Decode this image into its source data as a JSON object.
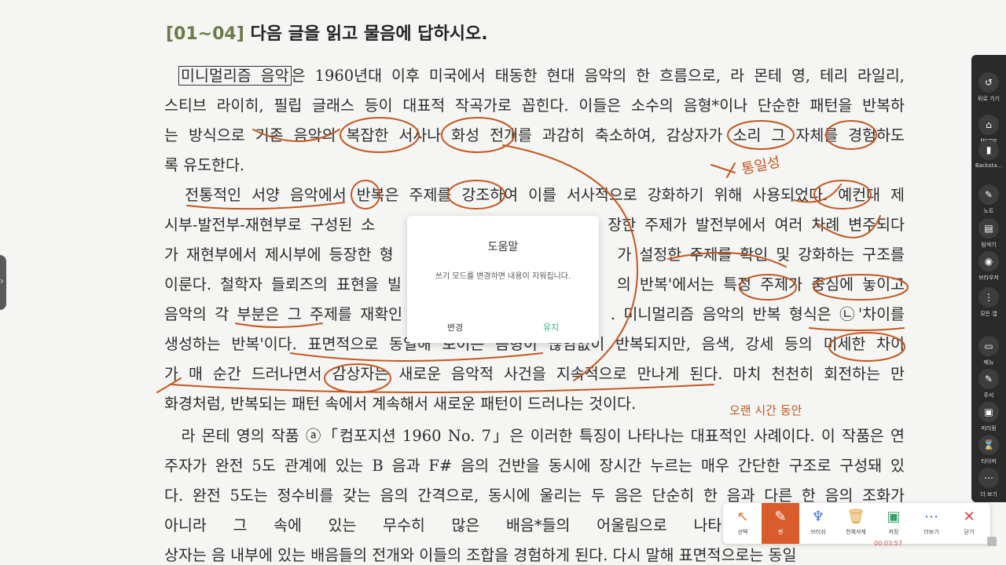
{
  "heading": {
    "num": "[01~04]",
    "text": "다음 글을 읽고 물음에 답하시오."
  },
  "paragraphs": [
    {
      "boxed": "미니멀리즘 음악",
      "lines": [
        "은 1960년대 이후 미국에서 태동한 현대 음악의 한 흐름으로, 라 몬테 영, 테리 라일리,",
        "스티브 라이히, 필립 글래스 등이 대표적 작곡가로 꼽힌다. 이들은 소수의 음형*이나 단순한 패턴을 반복하",
        "는 방식으로 기존 음악의 복잡한 서사나 화성 전개를 과감히 축소하여, 감상자가 소리 그 자체를 경험하도",
        "록 유도한다."
      ]
    },
    {
      "lines": [
        "　전통적인 서양 음악에서 반복은 주제를 강조하여 이를 서사적으로 강화하기 위해 사용되었다. 예컨대 제",
        "시부-발전부-재현부로 구성된 소　　　　　　　　　　　　장한 주제가 발전부에서 여러 차례 변주되다",
        "가 재현부에서 제시부에 등장한 형　　　　　　　　　　　　가 설정한 주제를 확인 및 강화하는 구조를",
        "이룬다. 철학자 들뢰즈의 표현을 빌　　　　　　　　　　　의 반복'에서는 특정 주제가 중심에 놓이고",
        "음악의 각 부분은 그 주제를 재확인　　　　　　　　　　　. 미니멀리즘 음악의 반복 형식은 ㉡'차이를",
        "생성하는 반복'이다. 표면적으로 동일해 보이는 음형이 끊임없이 반복되지만, 음색, 강세 등의 미세한 차이",
        "가 매 순간 드러나면서 감상자는 새로운 음악적 사건을 지속적으로 만나게 된다. 마치 천천히 회전하는 만",
        "화경처럼, 반복되는 패턴 속에서 계속해서 새로운 패턴이 드러나는 것이다."
      ]
    },
    {
      "lines": [
        "　라 몬테 영의 작품 ⓐ「컴포지션 1960 No. 7」은 이러한 특징이 나타나는 대표적인 사례이다. 이 작품은 연",
        "주자가 완전 5도 관계에 있는 B 음과 F# 음의 건반을 동시에 장시간 누르는 매우 간단한 구조로 구성돼 있",
        "다. 완전 5도는 정수비를 갖는 음의 간격으로, 동시에 울리는 두 음은 단순히 한 음과 다른 한 음의 조화가",
        "아니라 그 속에 있는 무수히 많은 배음*들의 어울림으로 나타난다. 두 음이 가능",
        "상자는 음 내부에 있는 배음들의 전개와 이들의 조합을 경험하게 된다. 다시 말해 표면적으로는 동일"
      ]
    }
  ],
  "handwriting": [
    "통일성",
    "오랜 시간 동안"
  ],
  "dialog": {
    "title": "도움말",
    "message": "쓰기 모드를 변경하면 내용이 지워집니다.",
    "change": "변경",
    "keep": "유지"
  },
  "sidebar": [
    {
      "label": "뒤로 가기",
      "icon": "back-icon",
      "glyph": "↺"
    },
    {
      "label": "Home",
      "icon": "home-icon",
      "glyph": "⌂"
    },
    {
      "label": "Backsta...",
      "icon": "backstage-icon",
      "glyph": "▮"
    },
    {
      "label": "노트",
      "icon": "notes-icon",
      "glyph": "✎"
    },
    {
      "label": "탐색기",
      "icon": "explorer-icon",
      "glyph": "▤"
    },
    {
      "label": "브라우저",
      "icon": "browser-icon",
      "glyph": "◉"
    },
    {
      "label": "모든 앱",
      "icon": "all-apps-icon",
      "glyph": "⋮"
    },
    {
      "label": "메뉴",
      "icon": "menu-icon",
      "glyph": "▭"
    },
    {
      "label": "주석",
      "icon": "annotation-icon",
      "glyph": "✎"
    },
    {
      "label": "미러링",
      "icon": "mirroring-icon",
      "glyph": "▣"
    },
    {
      "label": "타이머",
      "icon": "timer-icon",
      "glyph": "⌛"
    },
    {
      "label": "더 보기",
      "icon": "more-icon",
      "glyph": "⋯"
    }
  ],
  "toolbar": [
    {
      "label": "선택",
      "icon": "cursor-icon",
      "glyph": "↖",
      "color": "#e07a2f",
      "active": false
    },
    {
      "label": "펜",
      "icon": "pen-icon",
      "glyph": "✎",
      "color": "#ffffff",
      "active": true
    },
    {
      "label": "브러쉬",
      "icon": "brush-icon",
      "glyph": "♆",
      "color": "#3a6fd8",
      "active": false
    },
    {
      "label": "전체삭제",
      "icon": "trash-icon",
      "glyph": "🗑",
      "color": "#e0a030",
      "active": false
    },
    {
      "label": "저장",
      "icon": "save-icon",
      "glyph": "▣",
      "color": "#3aa06a",
      "active": false
    },
    {
      "label": "더보기",
      "icon": "more-icon",
      "glyph": "⋯",
      "color": "#3a6fd8",
      "active": false
    },
    {
      "label": "닫기",
      "icon": "close-icon",
      "glyph": "✕",
      "color": "#d84040",
      "active": false
    }
  ],
  "timer": "00:03:57",
  "colors": {
    "ink": "#c4571f",
    "accent": "#d95c2d",
    "keep": "#2ab08f",
    "heading_num": "#6b7a48"
  }
}
